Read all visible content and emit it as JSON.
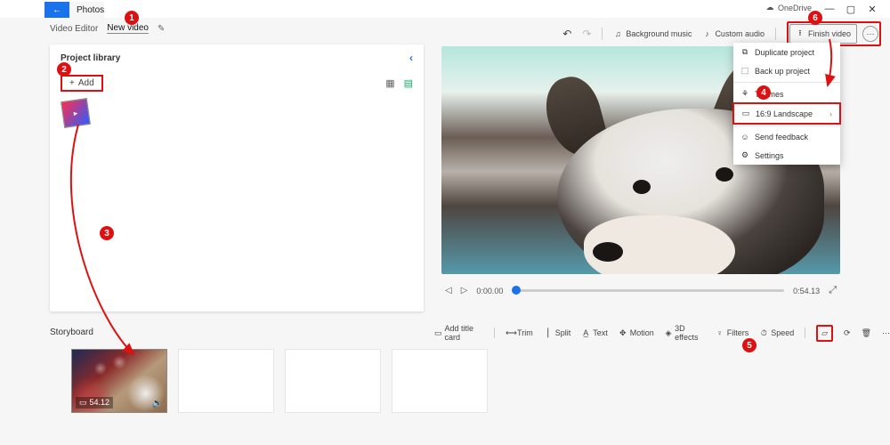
{
  "titlebar": {
    "onedrive_label": "OneDrive",
    "minimize": "—",
    "maximize": "▢",
    "close": "✕"
  },
  "app": {
    "back": "←",
    "title": "Photos"
  },
  "breadcrumb": {
    "root": "Video Editor",
    "current": "New video",
    "edit_glyph": "✎"
  },
  "toolbar": {
    "undo": "↶",
    "redo": "↷",
    "bg_music": "Background music",
    "custom_audio": "Custom audio",
    "finish": "Finish video",
    "export_glyph": "⭱",
    "more": "⋯",
    "music_glyph": "♫",
    "audio_glyph": "♪"
  },
  "library": {
    "title": "Project library",
    "collapse": "‹",
    "add_glyph": "+",
    "add_label": "Add",
    "grid_glyph": "▦",
    "list_glyph": "▤",
    "play_glyph": "▸"
  },
  "preview_controls": {
    "prev": "◁",
    "play": "▷",
    "time_current": "0:00.00",
    "time_total": "0:54.13",
    "expand": "⤢"
  },
  "storyboard": {
    "label": "Storyboard",
    "tools": {
      "add_title": "Add title card",
      "trim": "Trim",
      "split": "Split",
      "text": "Text",
      "motion": "Motion",
      "effects": "3D effects",
      "filters": "Filters",
      "speed": "Speed",
      "crop": "▱",
      "rotate": "⟳",
      "delete": "🗑",
      "more": "⋯"
    },
    "clip_duration": "54.12",
    "duration_glyph": "▭",
    "sound_glyph": "🔈"
  },
  "menu": {
    "duplicate": "Duplicate project",
    "backup": "Back up project",
    "themes": "Themes",
    "aspect": "16:9 Landscape",
    "feedback": "Send feedback",
    "settings": "Settings",
    "glyphs": {
      "dup": "⧉",
      "backup": "⬚",
      "themes": "⚘",
      "aspect": "▭",
      "feedback": "☺",
      "settings": "⚙",
      "arrow": "›"
    }
  },
  "annotations": {
    "b1": "1",
    "b2": "2",
    "b3": "3",
    "b4": "4",
    "b5": "5",
    "b6": "6"
  }
}
